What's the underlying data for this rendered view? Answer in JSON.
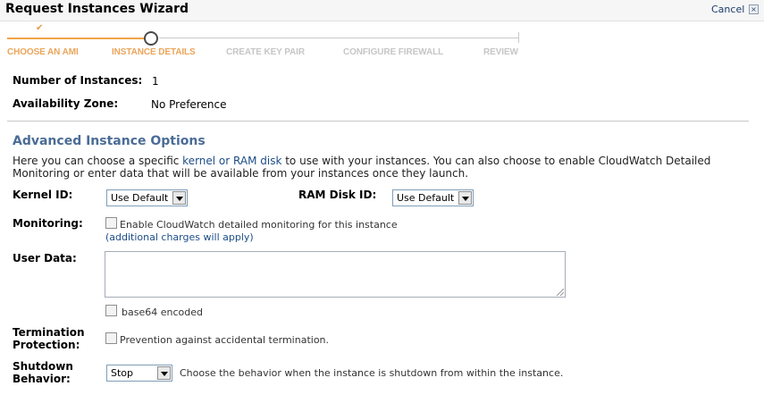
{
  "window": {
    "title": "Request Instances Wizard",
    "cancel_label": "Cancel",
    "close_glyph": "×"
  },
  "wizard": {
    "check_glyph": "✔",
    "steps": [
      {
        "label": "CHOOSE AN AMI",
        "state": "done"
      },
      {
        "label": "INSTANCE DETAILS",
        "state": "current"
      },
      {
        "label": "CREATE KEY PAIR",
        "state": "todo"
      },
      {
        "label": "CONFIGURE FIREWALL",
        "state": "todo"
      },
      {
        "label": "REVIEW",
        "state": "todo"
      }
    ]
  },
  "summary": {
    "instances_label": "Number of Instances:",
    "instances_value": "1",
    "zone_label": "Availability Zone:",
    "zone_value": "No Preference"
  },
  "advanced": {
    "title": "Advanced Instance Options",
    "desc_pre": "Here you can choose a specific ",
    "desc_link": "kernel or RAM disk",
    "desc_post": " to use with your instances. You can also choose to enable CloudWatch Detailed Monitoring or enter data that will be available from your instances once they launch.",
    "kernel_label": "Kernel ID:",
    "kernel_value": "Use Default",
    "ramdisk_label": "RAM Disk ID:",
    "ramdisk_value": "Use Default",
    "monitoring_label": "Monitoring:",
    "monitoring_checkbox": "Enable CloudWatch detailed monitoring for this instance",
    "monitoring_checked": false,
    "monitoring_note": "(additional charges will apply)",
    "userdata_label": "User Data:",
    "userdata_value": "",
    "base64_label": "base64 encoded",
    "base64_checked": false,
    "termination_label_1": "Termination",
    "termination_label_2": "Protection:",
    "termination_checkbox": "Prevention against accidental termination.",
    "termination_checked": false,
    "shutdown_label_1": "Shutdown",
    "shutdown_label_2": "Behavior:",
    "shutdown_value": "Stop",
    "shutdown_help": "Choose the behavior when the instance is shutdown from within the instance."
  },
  "colors": {
    "accent_orange": "#f0a447",
    "section_blue": "#4a6c96",
    "link_blue": "#1d4d86"
  }
}
